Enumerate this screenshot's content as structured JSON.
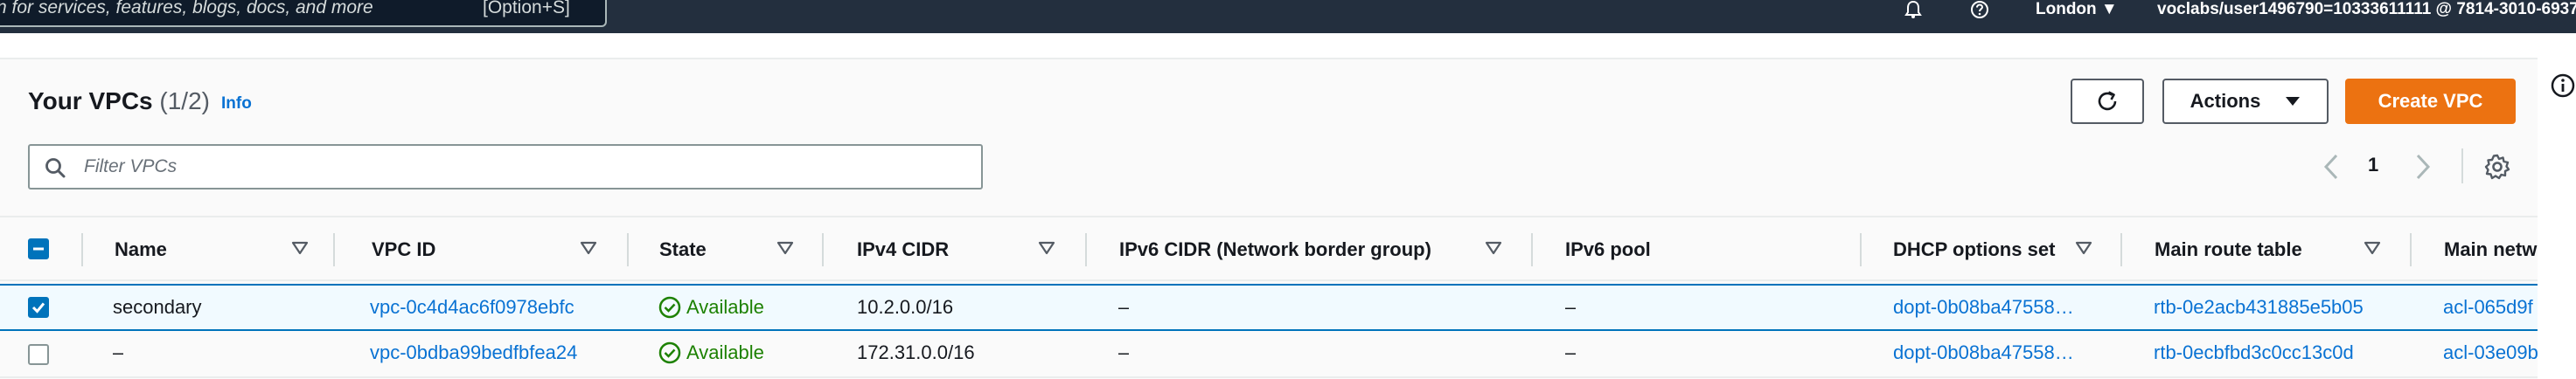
{
  "nav": {
    "search_placeholder": "n for services, features, blogs, docs, and more",
    "search_shortcut": "[Option+S]",
    "region": "London ▼",
    "account": "voclabs/user1496790=10333611111 @ 7814-3010-6937"
  },
  "header": {
    "title": "Your VPCs",
    "count": "(1/2)",
    "info": "Info"
  },
  "toolbar": {
    "actions_label": "Actions",
    "create_label": "Create VPC"
  },
  "filter": {
    "placeholder": "Filter VPCs",
    "value": ""
  },
  "pager": {
    "page": "1"
  },
  "table": {
    "columns": [
      "Name",
      "VPC ID",
      "State",
      "IPv4 CIDR",
      "IPv6 CIDR (Network border group)",
      "IPv6 pool",
      "DHCP options set",
      "Main route table",
      "Main netw"
    ],
    "rows": [
      {
        "selected": true,
        "name": "secondary",
        "vpc_id": "vpc-0c4d4ac6f0978ebfc",
        "state": "Available",
        "ipv4": "10.2.0.0/16",
        "ipv6": "–",
        "ipv6_pool": "–",
        "dhcp": "dopt-0b08ba47558…",
        "route_table": "rtb-0e2acb431885e5b05",
        "network_acl": "acl-065d9f"
      },
      {
        "selected": false,
        "name": "–",
        "vpc_id": "vpc-0bdba99bedfbfea24",
        "state": "Available",
        "ipv4": "172.31.0.0/16",
        "ipv6": "–",
        "ipv6_pool": "–",
        "dhcp": "dopt-0b08ba47558…",
        "route_table": "rtb-0ecbfbd3c0cc13c0d",
        "network_acl": "acl-03e09b"
      }
    ]
  },
  "colors": {
    "nav_bg": "#232f3e",
    "primary": "#ec7211",
    "link": "#0972d3",
    "success": "#1d8102",
    "selected_border": "#0073bb",
    "selected_bg": "#f1faff"
  },
  "icons": [
    "search-icon",
    "bell-icon",
    "help-icon",
    "info-icon",
    "refresh-icon",
    "caret-down-icon",
    "chevron-left-icon",
    "chevron-right-icon",
    "gear-icon",
    "sort-icon",
    "check-circle-icon"
  ]
}
